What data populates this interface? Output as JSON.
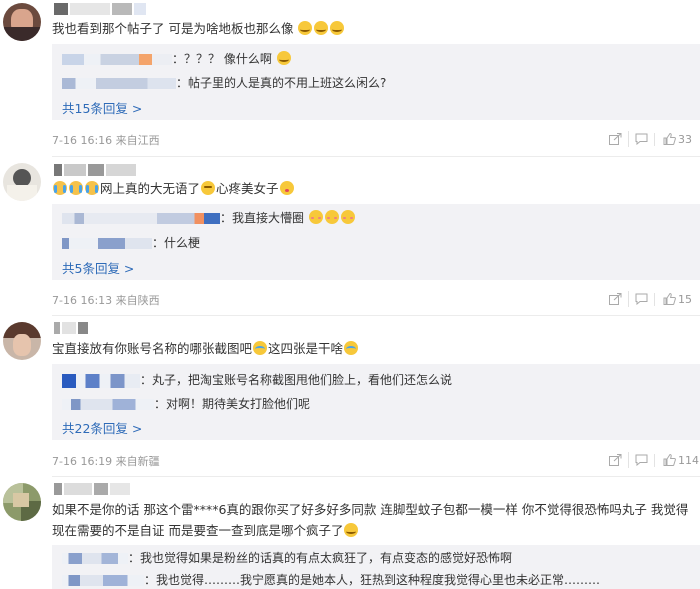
{
  "comments": [
    {
      "text": "我也看到那个帖子了 可是为啥地板也那么像",
      "replies": [
        {
          "text": "：？？？ 像什么啊"
        },
        {
          "text": "：帖子里的人是真的不用上班这么闲么?"
        }
      ],
      "more_label": "共15条回复 >",
      "meta": "7-16 16:16  来自江西",
      "likes": "33"
    },
    {
      "text_a": "网上真的大无语了",
      "text_b": "心疼美女子",
      "replies": [
        {
          "text": "：我直接大懵圈"
        },
        {
          "text": "：什么梗"
        }
      ],
      "more_label": "共5条回复 >",
      "meta": "7-16 16:13  来自陕西",
      "likes": "15"
    },
    {
      "text_a": "宝直接放有你账号名称的哪张截图吧",
      "text_b": "这四张是干啥",
      "replies": [
        {
          "text": "：丸子，把淘宝账号名称截图甩他们脸上，看他们还怎么说"
        },
        {
          "text": "：对啊！期待美女打脸他们呢"
        }
      ],
      "more_label": "共22条回复 >",
      "meta": "7-16 16:19  来自新疆",
      "likes": "114"
    },
    {
      "text": "如果不是你的话 那这个雷****6真的跟你买了好多好多同款 连脚型蚊子包都一模一样 你不觉得很恐怖吗丸子 我觉得现在需要的不是自证 而是要查一查到底是哪个疯子了",
      "replies": [
        {
          "text": "：我也觉得如果是粉丝的话真的有点太疯狂了，有点变态的感觉好恐怖啊"
        },
        {
          "text": "：我也觉得………我宁愿真的是她本人，狂热到这种程度我觉得心里也未必正常………"
        }
      ]
    }
  ],
  "icons": {
    "share": "share-icon",
    "comment": "comment-icon",
    "like": "thumbs-up-icon"
  },
  "colors": {
    "link": "#2e6bb8",
    "reply_bg": "#f2f2f5",
    "meta": "#999999"
  }
}
